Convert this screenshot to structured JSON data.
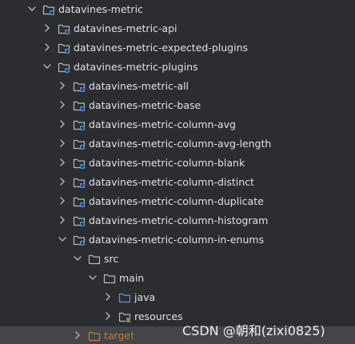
{
  "tree": {
    "items": [
      {
        "label": "datavines-metric",
        "icon": "module-folder-icon",
        "expanded": true,
        "depth": 0
      },
      {
        "label": "datavines-metric-api",
        "icon": "module-folder-icon",
        "expanded": false,
        "depth": 1
      },
      {
        "label": "datavines-metric-expected-plugins",
        "icon": "module-folder-icon",
        "expanded": false,
        "depth": 1
      },
      {
        "label": "datavines-metric-plugins",
        "icon": "module-folder-icon",
        "expanded": true,
        "depth": 1
      },
      {
        "label": "datavines-metric-all",
        "icon": "module-folder-icon",
        "expanded": false,
        "depth": 2
      },
      {
        "label": "datavines-metric-base",
        "icon": "module-folder-icon",
        "expanded": false,
        "depth": 2
      },
      {
        "label": "datavines-metric-column-avg",
        "icon": "module-folder-icon",
        "expanded": false,
        "depth": 2
      },
      {
        "label": "datavines-metric-column-avg-length",
        "icon": "module-folder-icon",
        "expanded": false,
        "depth": 2
      },
      {
        "label": "datavines-metric-column-blank",
        "icon": "module-folder-icon",
        "expanded": false,
        "depth": 2
      },
      {
        "label": "datavines-metric-column-distinct",
        "icon": "module-folder-icon",
        "expanded": false,
        "depth": 2
      },
      {
        "label": "datavines-metric-column-duplicate",
        "icon": "module-folder-icon",
        "expanded": false,
        "depth": 2
      },
      {
        "label": "datavines-metric-column-histogram",
        "icon": "module-folder-icon",
        "expanded": false,
        "depth": 2
      },
      {
        "label": "datavines-metric-column-in-enums",
        "icon": "module-folder-icon",
        "expanded": true,
        "depth": 2
      },
      {
        "label": "src",
        "icon": "folder-icon",
        "expanded": true,
        "depth": 3
      },
      {
        "label": "main",
        "icon": "folder-icon",
        "expanded": true,
        "depth": 4
      },
      {
        "label": "java",
        "icon": "source-root-folder-icon",
        "expanded": false,
        "depth": 5
      },
      {
        "label": "resources",
        "icon": "resources-root-folder-icon",
        "expanded": false,
        "depth": 5
      },
      {
        "label": "target",
        "icon": "excluded-folder-icon",
        "expanded": false,
        "depth": 3,
        "selected": true
      }
    ]
  },
  "watermark": {
    "text": "CSDN @朝和(zixi0825)"
  },
  "colors": {
    "background": "#2b2d30",
    "text": "#dfe1e5",
    "excluded_text": "#c47b3b",
    "folder_outline": "#b4b8bf",
    "module_badge": "#4a8bd6",
    "source_root": "#5a9ae6",
    "selected_row": "#43454a"
  }
}
